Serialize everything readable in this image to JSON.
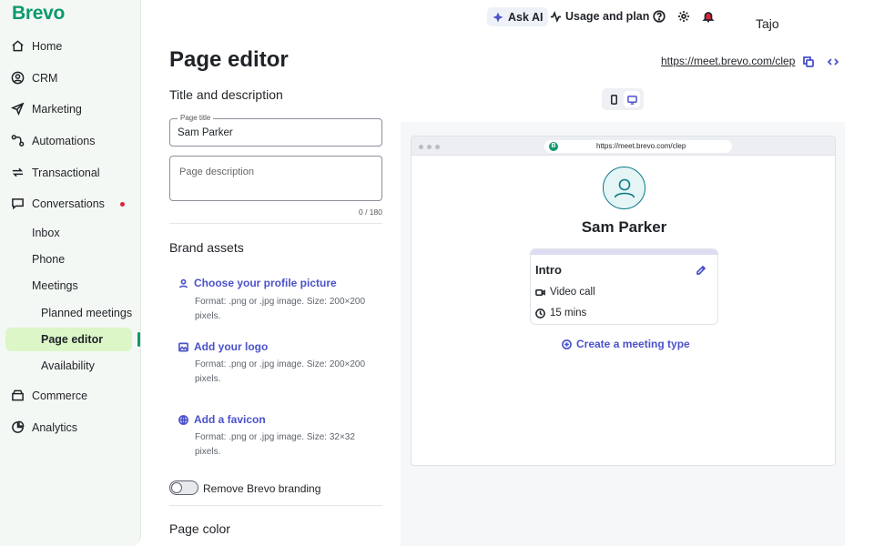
{
  "sidebar": {
    "logo": "Brevo",
    "nav": [
      {
        "label": "Home",
        "icon": "home-icon"
      },
      {
        "label": "CRM",
        "icon": "user-circle-icon"
      },
      {
        "label": "Marketing",
        "icon": "send-icon"
      },
      {
        "label": "Automations",
        "icon": "automation-icon"
      },
      {
        "label": "Transactional",
        "icon": "repeat-icon"
      },
      {
        "label": "Conversations",
        "icon": "chat-icon"
      }
    ],
    "sub_items": [
      "Inbox",
      "Phone",
      "Meetings"
    ],
    "meeting_items": [
      "Planned meetings",
      "Page editor",
      "Availability"
    ],
    "nav_bottom": [
      {
        "label": "Commerce",
        "icon": "shop-icon"
      },
      {
        "label": "Analytics",
        "icon": "pie-chart-icon"
      }
    ],
    "active_item": "Page editor",
    "accent_color": "#0b996e"
  },
  "topbar": {
    "ask_ai": "Ask AI",
    "usage": "Usage and plan",
    "user": "Tajo"
  },
  "editor": {
    "title": "Page editor",
    "section_title_desc": "Title and description",
    "page_title_label": "Page title",
    "page_title_value": "Sam Parker",
    "page_description_placeholder": "Page description",
    "counter": "0 / 180",
    "section_brand": "Brand assets",
    "assets": [
      {
        "label": "Choose your profile picture",
        "desc": "Format: .png or .jpg image. Size: 200×200 pixels.",
        "icon": "user-icon"
      },
      {
        "label": "Add your logo",
        "desc": "Format: .png or .jpg image. Size: 200×200 pixels.",
        "icon": "image-icon"
      },
      {
        "label": "Add a favicon",
        "desc": "Format: .png or .jpg image. Size: 32×32 pixels.",
        "icon": "globe-icon"
      }
    ],
    "remove_branding": "Remove Brevo branding",
    "section_color": "Page color"
  },
  "share": {
    "url": "https://meet.brevo.com/clep"
  },
  "preview": {
    "address": "https://meet.brevo.com/clep",
    "favicon_letter": "B",
    "name": "Sam Parker",
    "card": {
      "title": "Intro",
      "type": "Video call",
      "duration": "15 mins"
    },
    "create_link": "Create a meeting type",
    "link_color": "#4b52c9"
  }
}
